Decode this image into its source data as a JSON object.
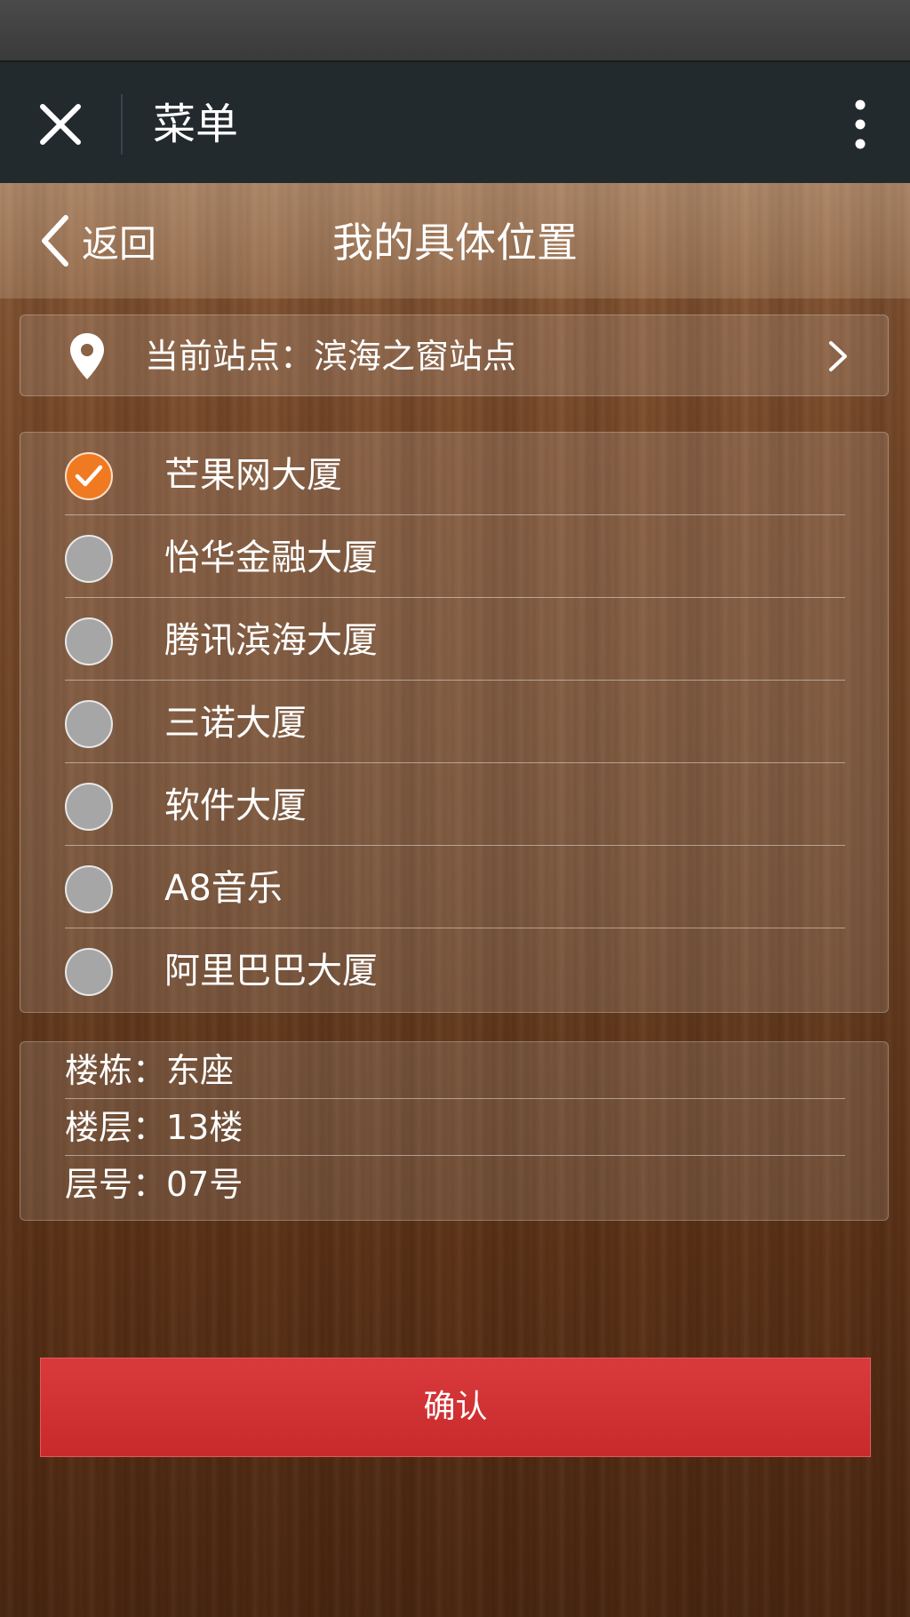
{
  "app_bar": {
    "title": "菜单",
    "close_icon": "close-icon",
    "more_icon": "more-vertical-icon"
  },
  "nav": {
    "back_label": "返回",
    "title": "我的具体位置"
  },
  "station": {
    "text": "当前站点：滨海之窗站点",
    "icon": "location-pin-icon"
  },
  "buildings": {
    "selected_index": 0,
    "items": [
      {
        "label": "芒果网大厦",
        "checked": true
      },
      {
        "label": "怡华金融大厦",
        "checked": false
      },
      {
        "label": "腾讯滨海大厦",
        "checked": false
      },
      {
        "label": "三诺大厦",
        "checked": false
      },
      {
        "label": "软件大厦",
        "checked": false
      },
      {
        "label": "A8音乐",
        "checked": false
      },
      {
        "label": "阿里巴巴大厦",
        "checked": false
      }
    ]
  },
  "details": {
    "building": "楼栋：东座",
    "floor": "楼层：13楼",
    "room": "层号：07号"
  },
  "confirm_label": "确认",
  "colors": {
    "accent_orange": "#f07a22",
    "confirm_red": "#d0302f",
    "app_bar": "#222a2e"
  }
}
